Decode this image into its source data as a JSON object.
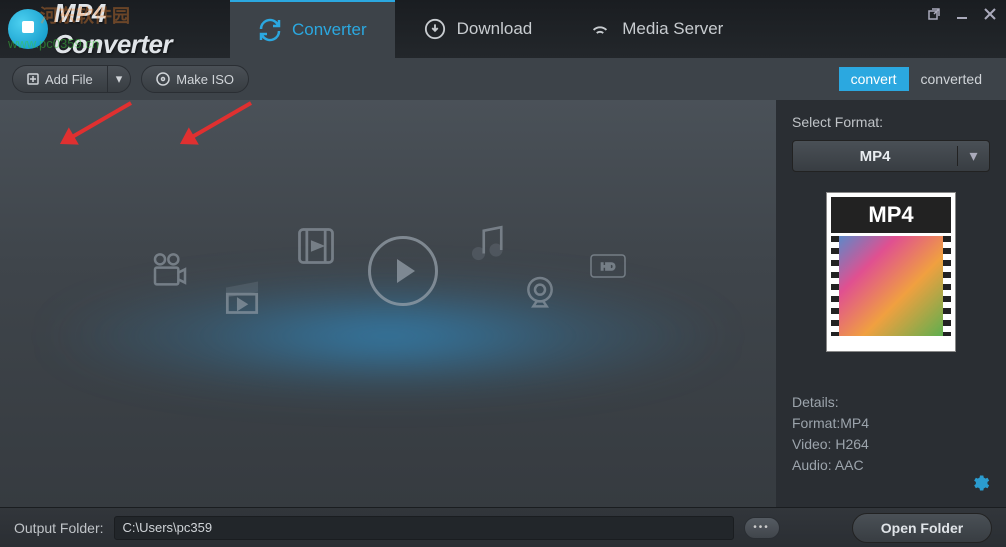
{
  "app": {
    "title": "MP4 Converter",
    "watermark_text": "河东软件园",
    "watermark_url": "www.pc0359.cn"
  },
  "tabs": {
    "converter": "Converter",
    "download": "Download",
    "media_server": "Media Server"
  },
  "toolbar": {
    "add_file": "Add File",
    "make_iso": "Make ISO",
    "convert_tab": "convert",
    "converted_tab": "converted"
  },
  "sidebar": {
    "select_format_label": "Select Format:",
    "selected_format": "MP4",
    "preview_label": "MP4",
    "details_heading": "Details:",
    "format_line": "Format:MP4",
    "video_line": "Video: H264",
    "audio_line": "Audio: AAC"
  },
  "footer": {
    "output_label": "Output Folder:",
    "output_path": "C:\\Users\\pc359",
    "browse": "•••",
    "open_folder": "Open Folder"
  }
}
